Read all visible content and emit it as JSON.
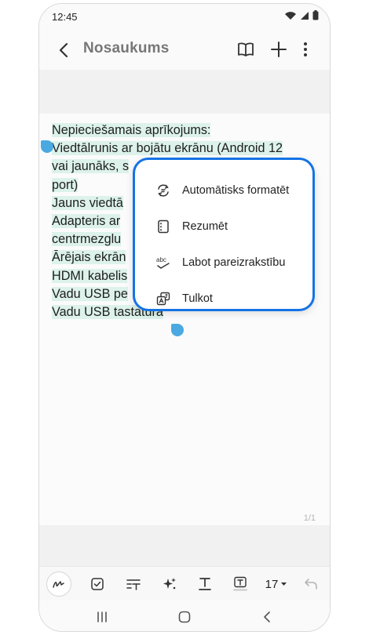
{
  "status_bar": {
    "time": "12:45",
    "icons": [
      "wifi-icon",
      "signal-icon",
      "battery-icon"
    ]
  },
  "app_bar": {
    "title": "Nosaukums",
    "actions": [
      "back-icon",
      "book-icon",
      "plus-icon",
      "more-vertical-icon"
    ]
  },
  "note": {
    "lines": [
      "Nepieciešamais aprīkojums:",
      "Viedtālrunis ar bojātu ekrānu (Android 12",
      "vai jaunāks, s",
      "port)",
      "Jauns viedtā",
      "Adapteris ar",
      "centrmezglu",
      "Ārējais ekrān",
      "HDMI kabelis",
      "Vadu USB pe",
      "Vadu USB tastatūra"
    ],
    "page_number": "1/1"
  },
  "context_menu": {
    "items": [
      {
        "label": "Automātisks formatēt",
        "icon": "auto-format-icon"
      },
      {
        "label": "Rezumēt",
        "icon": "summary-icon"
      },
      {
        "label": "Labot pareizrakstību",
        "icon": "spell-check-icon"
      },
      {
        "label": "Tulkot",
        "icon": "translate-icon"
      }
    ],
    "accent": "#1473e6"
  },
  "toolbar": {
    "tools": [
      "pen-icon",
      "checkbox-icon",
      "text-style-icon",
      "ai-sparkle-icon",
      "text-underline-icon",
      "text-box-icon"
    ],
    "font_size": "17",
    "undo_icon": "undo-icon"
  },
  "nav_bar": {
    "buttons": [
      "recent-apps-icon",
      "home-icon",
      "back-nav-icon"
    ]
  },
  "colors": {
    "highlight": "#dcf2ea",
    "selection_handle": "#4aa9e0"
  }
}
